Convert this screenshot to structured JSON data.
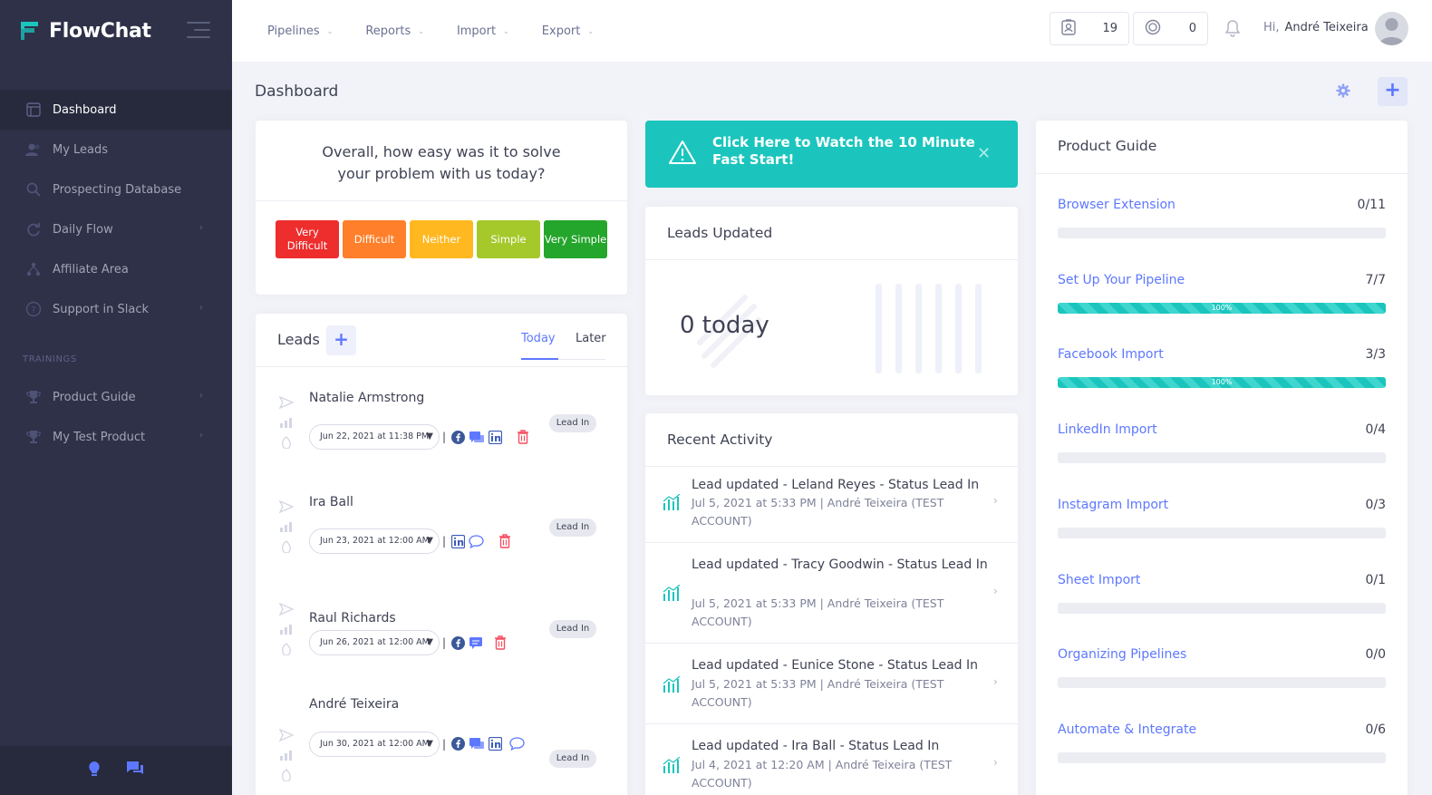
{
  "app": {
    "name": "FlowChat"
  },
  "sidebar": {
    "items": [
      {
        "label": "Dashboard",
        "icon": "dashboard-icon",
        "active": true
      },
      {
        "label": "My Leads",
        "icon": "users-icon"
      },
      {
        "label": "Prospecting Database",
        "icon": "search-icon"
      },
      {
        "label": "Daily Flow",
        "icon": "refresh-icon",
        "chevron": true
      },
      {
        "label": "Affiliate Area",
        "icon": "network-icon"
      },
      {
        "label": "Support in Slack",
        "icon": "question-icon",
        "chevron": true
      }
    ],
    "section_label": "TRAININGS",
    "training_items": [
      {
        "label": "Product Guide",
        "icon": "trophy-icon",
        "chevron": true
      },
      {
        "label": "My Test Product",
        "icon": "trophy-icon",
        "chevron": true
      }
    ]
  },
  "topbar": {
    "menu": [
      "Pipelines",
      "Reports",
      "Import",
      "Export"
    ],
    "counter_one": "19",
    "counter_two": "0",
    "greeting": "Hi,",
    "user_name": "André Teixeira"
  },
  "page": {
    "title": "Dashboard"
  },
  "survey": {
    "question_line1": "Overall, how easy was it to solve",
    "question_line2": "your problem with us today?",
    "options": [
      {
        "label": "Very Difficult",
        "color": "#ee2d2d"
      },
      {
        "label": "Difficult",
        "color": "#ff7f2a"
      },
      {
        "label": "Neither",
        "color": "#ffb81f"
      },
      {
        "label": "Simple",
        "color": "#a5c92b"
      },
      {
        "label": "Very Simple",
        "color": "#24a52b"
      }
    ]
  },
  "leads": {
    "title": "Leads",
    "tab_today": "Today",
    "tab_later": "Later",
    "items": [
      {
        "name": "Natalie Armstrong",
        "date": "Jun 22, 2021 at 11:38 PM",
        "status": "Lead In"
      },
      {
        "name": "Ira Ball",
        "date": "Jun 23, 2021 at 12:00 AM",
        "status": "Lead In"
      },
      {
        "name": "Raul Richards",
        "date": "Jun 26, 2021 at 12:00 AM",
        "status": "Lead In"
      },
      {
        "name": "André Teixeira",
        "date": "Jun 30, 2021 at 12:00 AM",
        "status": "Lead In"
      }
    ]
  },
  "banner": {
    "text": "Click Here to Watch the 10 Minute Fast Start!"
  },
  "leads_updated": {
    "title": "Leads Updated",
    "value": "0 today"
  },
  "recent_activity": {
    "title": "Recent Activity",
    "items": [
      {
        "title": "Lead updated - Leland Reyes - Status Lead In",
        "meta": "Jul 5, 2021 at 5:33 PM | André Teixeira (TEST ACCOUNT)"
      },
      {
        "title": "Lead updated - Tracy Goodwin - Status Lead In",
        "meta": "Jul 5, 2021 at 5:33 PM | André Teixeira (TEST ACCOUNT)"
      },
      {
        "title": "Lead updated - Eunice Stone - Status Lead In",
        "meta": "Jul 5, 2021 at 5:33 PM | André Teixeira (TEST ACCOUNT)"
      },
      {
        "title": "Lead updated - Ira Ball - Status Lead In",
        "meta": "Jul 4, 2021 at 12:20 AM | André Teixeira (TEST ACCOUNT)"
      }
    ]
  },
  "product_guide": {
    "title": "Product Guide",
    "items": [
      {
        "name": "Browser Extension",
        "count": "0/11",
        "progress": 0
      },
      {
        "name": "Set Up Your Pipeline",
        "count": "7/7",
        "progress": 100,
        "progress_label": "100%"
      },
      {
        "name": "Facebook Import",
        "count": "3/3",
        "progress": 100,
        "progress_label": "100%"
      },
      {
        "name": "LinkedIn Import",
        "count": "0/4",
        "progress": 0
      },
      {
        "name": "Instagram Import",
        "count": "0/3",
        "progress": 0
      },
      {
        "name": "Sheet Import",
        "count": "0/1",
        "progress": 0
      },
      {
        "name": "Organizing Pipelines",
        "count": "0/0",
        "progress": 0
      },
      {
        "name": "Automate & Integrate",
        "count": "0/6",
        "progress": 0
      }
    ]
  },
  "colors": {
    "accent": "#5d78ff",
    "teal": "#1bc5bd",
    "sidebar": "#2e3148",
    "danger": "#f64e60"
  }
}
